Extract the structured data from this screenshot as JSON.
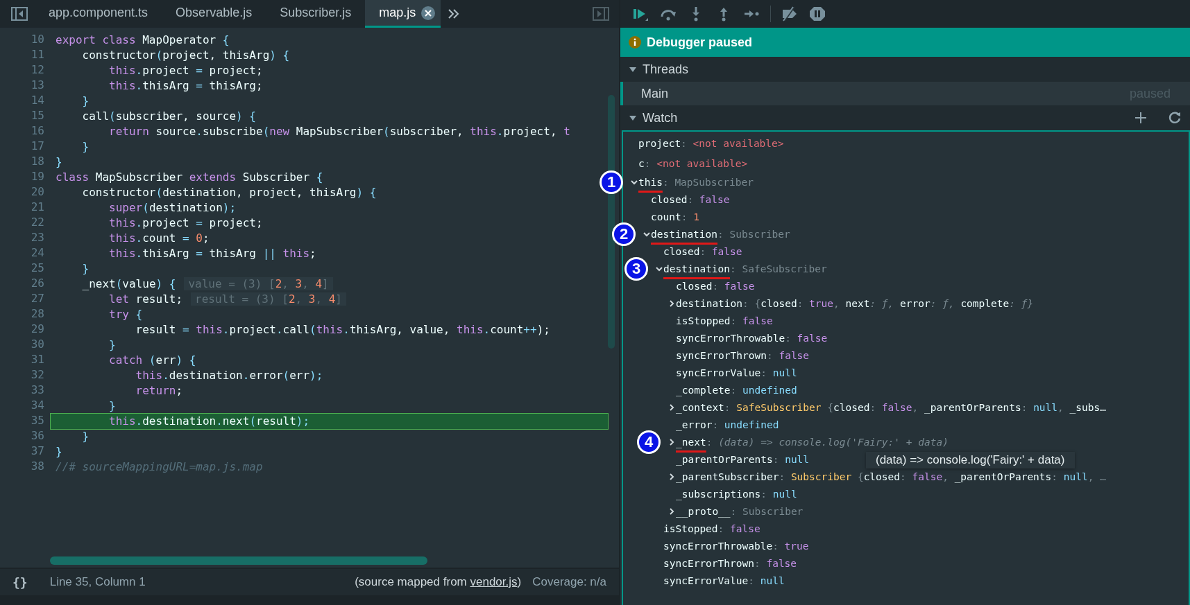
{
  "tabs": [
    {
      "label": "app.component.ts",
      "selected": false
    },
    {
      "label": "Observable.js",
      "selected": false
    },
    {
      "label": "Subscriber.js",
      "selected": false
    },
    {
      "label": "map.js",
      "selected": true
    }
  ],
  "code": [
    {
      "n": "10",
      "current": false,
      "tokens": [
        {
          "text": "export class ",
          "kind": "kw"
        },
        {
          "text": "MapOperator ",
          "kind": "id"
        },
        {
          "text": "{",
          "kind": "pu"
        }
      ]
    },
    {
      "n": "11",
      "current": false,
      "tokens": [
        {
          "text": "    constructor",
          "kind": "id"
        },
        {
          "text": "(",
          "kind": "pu"
        },
        {
          "text": "project, thisArg",
          "kind": "id"
        },
        {
          "text": ") {",
          "kind": "pu"
        }
      ]
    },
    {
      "n": "12",
      "current": false,
      "tokens": [
        {
          "text": "        this",
          "kind": "kw"
        },
        {
          "text": ".",
          "kind": "pu"
        },
        {
          "text": "project ",
          "kind": "id"
        },
        {
          "text": "=",
          "kind": "pu"
        },
        {
          "text": " project;",
          "kind": "id"
        }
      ]
    },
    {
      "n": "13",
      "current": false,
      "tokens": [
        {
          "text": "        this",
          "kind": "kw"
        },
        {
          "text": ".",
          "kind": "pu"
        },
        {
          "text": "thisArg ",
          "kind": "id"
        },
        {
          "text": "=",
          "kind": "pu"
        },
        {
          "text": " thisArg;",
          "kind": "id"
        }
      ]
    },
    {
      "n": "14",
      "current": false,
      "tokens": [
        {
          "text": "    }",
          "kind": "pu"
        }
      ]
    },
    {
      "n": "15",
      "current": false,
      "tokens": [
        {
          "text": "    call",
          "kind": "id"
        },
        {
          "text": "(",
          "kind": "pu"
        },
        {
          "text": "subscriber, source",
          "kind": "id"
        },
        {
          "text": ") {",
          "kind": "pu"
        }
      ]
    },
    {
      "n": "16",
      "current": false,
      "tokens": [
        {
          "text": "        return ",
          "kind": "kw"
        },
        {
          "text": "source",
          "kind": "id"
        },
        {
          "text": ".",
          "kind": "pu"
        },
        {
          "text": "subscribe",
          "kind": "id"
        },
        {
          "text": "(",
          "kind": "pu"
        },
        {
          "text": "new ",
          "kind": "kw"
        },
        {
          "text": "MapSubscriber",
          "kind": "id"
        },
        {
          "text": "(",
          "kind": "pu"
        },
        {
          "text": "subscriber, ",
          "kind": "id"
        },
        {
          "text": "this",
          "kind": "kw"
        },
        {
          "text": ".",
          "kind": "pu"
        },
        {
          "text": "project, ",
          "kind": "id"
        },
        {
          "text": "t",
          "kind": "kw"
        }
      ]
    },
    {
      "n": "17",
      "current": false,
      "tokens": [
        {
          "text": "    }",
          "kind": "pu"
        }
      ]
    },
    {
      "n": "18",
      "current": false,
      "tokens": [
        {
          "text": "}",
          "kind": "pu"
        }
      ]
    },
    {
      "n": "19",
      "current": false,
      "tokens": [
        {
          "text": "class ",
          "kind": "kw"
        },
        {
          "text": "MapSubscriber ",
          "kind": "id"
        },
        {
          "text": "extends ",
          "kind": "kw"
        },
        {
          "text": "Subscriber ",
          "kind": "id"
        },
        {
          "text": "{",
          "kind": "pu"
        }
      ]
    },
    {
      "n": "20",
      "current": false,
      "tokens": [
        {
          "text": "    constructor",
          "kind": "id"
        },
        {
          "text": "(",
          "kind": "pu"
        },
        {
          "text": "destination, project, thisArg",
          "kind": "id"
        },
        {
          "text": ") {",
          "kind": "pu"
        }
      ]
    },
    {
      "n": "21",
      "current": false,
      "tokens": [
        {
          "text": "        super",
          "kind": "kw"
        },
        {
          "text": "(",
          "kind": "pu"
        },
        {
          "text": "destination",
          "kind": "id"
        },
        {
          "text": ");",
          "kind": "pu"
        }
      ]
    },
    {
      "n": "22",
      "current": false,
      "tokens": [
        {
          "text": "        this",
          "kind": "kw"
        },
        {
          "text": ".",
          "kind": "pu"
        },
        {
          "text": "project ",
          "kind": "id"
        },
        {
          "text": "=",
          "kind": "pu"
        },
        {
          "text": " project;",
          "kind": "id"
        }
      ]
    },
    {
      "n": "23",
      "current": false,
      "tokens": [
        {
          "text": "        this",
          "kind": "kw"
        },
        {
          "text": ".",
          "kind": "pu"
        },
        {
          "text": "count ",
          "kind": "id"
        },
        {
          "text": "= ",
          "kind": "pu"
        },
        {
          "text": "0",
          "kind": "num"
        },
        {
          "text": ";",
          "kind": "id"
        }
      ]
    },
    {
      "n": "24",
      "current": false,
      "tokens": [
        {
          "text": "        this",
          "kind": "kw"
        },
        {
          "text": ".",
          "kind": "pu"
        },
        {
          "text": "thisArg ",
          "kind": "id"
        },
        {
          "text": "=",
          "kind": "pu"
        },
        {
          "text": " thisArg ",
          "kind": "id"
        },
        {
          "text": "|| ",
          "kind": "pu"
        },
        {
          "text": "this",
          "kind": "kw"
        },
        {
          "text": ";",
          "kind": "id"
        }
      ]
    },
    {
      "n": "25",
      "current": false,
      "tokens": [
        {
          "text": "    }",
          "kind": "pu"
        }
      ]
    },
    {
      "n": "26",
      "current": false,
      "tokens": [
        {
          "text": "    _next",
          "kind": "id"
        },
        {
          "text": "(",
          "kind": "pu"
        },
        {
          "text": "value",
          "kind": "id"
        },
        {
          "text": ") {",
          "kind": "pu"
        }
      ],
      "inline": [
        {
          "text": "value = (3) [",
          "kind": "dim"
        },
        {
          "text": "2",
          "kind": "num"
        },
        {
          "text": ", ",
          "kind": "dim"
        },
        {
          "text": "3",
          "kind": "num"
        },
        {
          "text": ", ",
          "kind": "dim"
        },
        {
          "text": "4",
          "kind": "num"
        },
        {
          "text": "]",
          "kind": "dim"
        }
      ]
    },
    {
      "n": "27",
      "current": false,
      "tokens": [
        {
          "text": "        let ",
          "kind": "kw"
        },
        {
          "text": "result;",
          "kind": "id"
        }
      ],
      "inline": [
        {
          "text": "result = (3) [",
          "kind": "dim"
        },
        {
          "text": "2",
          "kind": "num"
        },
        {
          "text": ", ",
          "kind": "dim"
        },
        {
          "text": "3",
          "kind": "num"
        },
        {
          "text": ", ",
          "kind": "dim"
        },
        {
          "text": "4",
          "kind": "num"
        },
        {
          "text": "]",
          "kind": "dim"
        }
      ]
    },
    {
      "n": "28",
      "current": false,
      "tokens": [
        {
          "text": "        try ",
          "kind": "kw"
        },
        {
          "text": "{",
          "kind": "pu"
        }
      ]
    },
    {
      "n": "29",
      "current": false,
      "tokens": [
        {
          "text": "            result ",
          "kind": "id"
        },
        {
          "text": "= ",
          "kind": "pu"
        },
        {
          "text": "this",
          "kind": "kw"
        },
        {
          "text": ".",
          "kind": "pu"
        },
        {
          "text": "project",
          "kind": "id"
        },
        {
          "text": ".",
          "kind": "pu"
        },
        {
          "text": "call",
          "kind": "id"
        },
        {
          "text": "(",
          "kind": "pu"
        },
        {
          "text": "this",
          "kind": "kw"
        },
        {
          "text": ".",
          "kind": "pu"
        },
        {
          "text": "thisArg, value, ",
          "kind": "id"
        },
        {
          "text": "this",
          "kind": "kw"
        },
        {
          "text": ".",
          "kind": "pu"
        },
        {
          "text": "count",
          "kind": "id"
        },
        {
          "text": "++",
          "kind": "pu"
        },
        {
          "text": ");",
          "kind": "id"
        }
      ]
    },
    {
      "n": "30",
      "current": false,
      "tokens": [
        {
          "text": "        }",
          "kind": "pu"
        }
      ]
    },
    {
      "n": "31",
      "current": false,
      "tokens": [
        {
          "text": "        catch ",
          "kind": "kw"
        },
        {
          "text": "(",
          "kind": "pu"
        },
        {
          "text": "err",
          "kind": "id"
        },
        {
          "text": ") {",
          "kind": "pu"
        }
      ]
    },
    {
      "n": "32",
      "current": false,
      "tokens": [
        {
          "text": "            this",
          "kind": "kw"
        },
        {
          "text": ".",
          "kind": "pu"
        },
        {
          "text": "destination",
          "kind": "id"
        },
        {
          "text": ".",
          "kind": "pu"
        },
        {
          "text": "error",
          "kind": "id"
        },
        {
          "text": "(",
          "kind": "pu"
        },
        {
          "text": "err",
          "kind": "id"
        },
        {
          "text": ");",
          "kind": "pu"
        }
      ]
    },
    {
      "n": "33",
      "current": false,
      "tokens": [
        {
          "text": "            return",
          "kind": "kw"
        },
        {
          "text": ";",
          "kind": "id"
        }
      ]
    },
    {
      "n": "34",
      "current": false,
      "tokens": [
        {
          "text": "        }",
          "kind": "pu"
        }
      ]
    },
    {
      "n": "35",
      "current": true,
      "tokens": [
        {
          "text": "        this",
          "kind": "kw"
        },
        {
          "text": ".",
          "kind": "pu"
        },
        {
          "text": "destination",
          "kind": "id"
        },
        {
          "text": ".",
          "kind": "pu"
        },
        {
          "text": "next",
          "kind": "id"
        },
        {
          "text": "(",
          "kind": "pu"
        },
        {
          "text": "result",
          "kind": "id"
        },
        {
          "text": ");",
          "kind": "pu"
        }
      ]
    },
    {
      "n": "36",
      "current": false,
      "tokens": [
        {
          "text": "    }",
          "kind": "pu"
        }
      ]
    },
    {
      "n": "37",
      "current": false,
      "tokens": [
        {
          "text": "}",
          "kind": "pu"
        }
      ]
    },
    {
      "n": "38",
      "current": false,
      "tokens": [
        {
          "text": "//# sourceMappingURL=map.js.map",
          "kind": "cm"
        }
      ]
    }
  ],
  "status_bar": {
    "pretty_print": "{}",
    "position": "Line 35, Column 1",
    "source_prefix": "(source mapped from ",
    "source_link": "vendor.js",
    "source_suffix": ")",
    "coverage": "Coverage: n/a"
  },
  "banner": "Debugger paused",
  "threads": {
    "title": "Threads",
    "expanded": true,
    "items": [
      {
        "name": "Main",
        "status": "paused",
        "selected": true
      }
    ]
  },
  "watch": {
    "title": "Watch",
    "expanded": true,
    "items": [
      {
        "name": "project",
        "value": [
          {
            "text": ": ",
            "kind": "dim"
          },
          {
            "text": "<not available>",
            "kind": "err"
          }
        ]
      },
      {
        "name": "c",
        "value": [
          {
            "text": ": ",
            "kind": "dim"
          },
          {
            "text": "<not available>",
            "kind": "err"
          }
        ]
      },
      {
        "name": "this",
        "value": [
          {
            "text": ": ",
            "kind": "dim"
          },
          {
            "text": "MapSubscriber",
            "kind": "type"
          }
        ],
        "expanded": true,
        "marker": "1",
        "underlined": true,
        "children": [
          {
            "name": "closed",
            "value": [
              {
                "text": ": ",
                "kind": "dim"
              },
              {
                "text": "false",
                "kind": "bool"
              }
            ]
          },
          {
            "name": "count",
            "value": [
              {
                "text": ": ",
                "kind": "dim"
              },
              {
                "text": "1",
                "kind": "num"
              }
            ]
          },
          {
            "name": "destination",
            "value": [
              {
                "text": ": ",
                "kind": "dim"
              },
              {
                "text": "Subscriber",
                "kind": "type"
              }
            ],
            "expanded": true,
            "marker": "2",
            "underlined": true,
            "children": [
              {
                "name": "closed",
                "value": [
                  {
                    "text": ": ",
                    "kind": "dim"
                  },
                  {
                    "text": "false",
                    "kind": "bool"
                  }
                ]
              },
              {
                "name": "destination",
                "value": [
                  {
                    "text": ": ",
                    "kind": "dim"
                  },
                  {
                    "text": "SafeSubscriber",
                    "kind": "type"
                  }
                ],
                "expanded": true,
                "marker": "3",
                "underlined": true,
                "children": [
                  {
                    "name": "closed",
                    "value": [
                      {
                        "text": ": ",
                        "kind": "dim"
                      },
                      {
                        "text": "false",
                        "kind": "bool"
                      }
                    ]
                  },
                  {
                    "name": "destination",
                    "expanded": false,
                    "value": [
                      {
                        "text": ": {",
                        "kind": "dim"
                      },
                      {
                        "text": "closed",
                        "kind": "plain"
                      },
                      {
                        "text": ": ",
                        "kind": "dim"
                      },
                      {
                        "text": "true",
                        "kind": "bool"
                      },
                      {
                        "text": ", ",
                        "kind": "dim"
                      },
                      {
                        "text": "next",
                        "kind": "plain"
                      },
                      {
                        "text": ": ƒ, ",
                        "kind": "fn"
                      },
                      {
                        "text": "error",
                        "kind": "plain"
                      },
                      {
                        "text": ": ƒ, ",
                        "kind": "fn"
                      },
                      {
                        "text": "complete",
                        "kind": "plain"
                      },
                      {
                        "text": ": ƒ}",
                        "kind": "fn"
                      }
                    ]
                  },
                  {
                    "name": "isStopped",
                    "value": [
                      {
                        "text": ": ",
                        "kind": "dim"
                      },
                      {
                        "text": "false",
                        "kind": "bool"
                      }
                    ]
                  },
                  {
                    "name": "syncErrorThrowable",
                    "value": [
                      {
                        "text": ": ",
                        "kind": "dim"
                      },
                      {
                        "text": "false",
                        "kind": "bool"
                      }
                    ]
                  },
                  {
                    "name": "syncErrorThrown",
                    "value": [
                      {
                        "text": ": ",
                        "kind": "dim"
                      },
                      {
                        "text": "false",
                        "kind": "bool"
                      }
                    ]
                  },
                  {
                    "name": "syncErrorValue",
                    "value": [
                      {
                        "text": ": ",
                        "kind": "dim"
                      },
                      {
                        "text": "null",
                        "kind": "null"
                      }
                    ]
                  },
                  {
                    "name": "_complete",
                    "value": [
                      {
                        "text": ": ",
                        "kind": "dim"
                      },
                      {
                        "text": "undefined",
                        "kind": "null"
                      }
                    ]
                  },
                  {
                    "name": "_context",
                    "expanded": false,
                    "value": [
                      {
                        "text": ": ",
                        "kind": "dim"
                      },
                      {
                        "text": "SafeSubscriber ",
                        "kind": "cls"
                      },
                      {
                        "text": "{",
                        "kind": "dim"
                      },
                      {
                        "text": "closed",
                        "kind": "plain"
                      },
                      {
                        "text": ": ",
                        "kind": "dim"
                      },
                      {
                        "text": "false",
                        "kind": "bool"
                      },
                      {
                        "text": ", ",
                        "kind": "dim"
                      },
                      {
                        "text": "_parentOrParents",
                        "kind": "plain"
                      },
                      {
                        "text": ": ",
                        "kind": "dim"
                      },
                      {
                        "text": "null",
                        "kind": "null"
                      },
                      {
                        "text": ", ",
                        "kind": "dim"
                      },
                      {
                        "text": "_subs…",
                        "kind": "plain"
                      }
                    ]
                  },
                  {
                    "name": "_error",
                    "value": [
                      {
                        "text": ": ",
                        "kind": "dim"
                      },
                      {
                        "text": "undefined",
                        "kind": "null"
                      }
                    ]
                  },
                  {
                    "name": "_next",
                    "expanded": false,
                    "marker": "4",
                    "underlined": true,
                    "value": [
                      {
                        "text": ": ",
                        "kind": "dim"
                      },
                      {
                        "text": "(data) => console.log('Fairy:' + data)",
                        "kind": "fn"
                      }
                    ],
                    "tooltip": "(data) => console.log('Fairy:' + data)"
                  },
                  {
                    "name": "_parentOrParents",
                    "value": [
                      {
                        "text": ": ",
                        "kind": "dim"
                      },
                      {
                        "text": "null",
                        "kind": "null"
                      }
                    ]
                  },
                  {
                    "name": "_parentSubscriber",
                    "expanded": false,
                    "value": [
                      {
                        "text": ": ",
                        "kind": "dim"
                      },
                      {
                        "text": "Subscriber ",
                        "kind": "cls"
                      },
                      {
                        "text": "{",
                        "kind": "dim"
                      },
                      {
                        "text": "closed",
                        "kind": "plain"
                      },
                      {
                        "text": ": ",
                        "kind": "dim"
                      },
                      {
                        "text": "false",
                        "kind": "bool"
                      },
                      {
                        "text": ", ",
                        "kind": "dim"
                      },
                      {
                        "text": "_parentOrParents",
                        "kind": "plain"
                      },
                      {
                        "text": ": ",
                        "kind": "dim"
                      },
                      {
                        "text": "null",
                        "kind": "null"
                      },
                      {
                        "text": ", …",
                        "kind": "dim"
                      }
                    ]
                  },
                  {
                    "name": "_subscriptions",
                    "value": [
                      {
                        "text": ": ",
                        "kind": "dim"
                      },
                      {
                        "text": "null",
                        "kind": "null"
                      }
                    ]
                  },
                  {
                    "name": "__proto__",
                    "expanded": false,
                    "value": [
                      {
                        "text": ": ",
                        "kind": "dim"
                      },
                      {
                        "text": "Subscriber",
                        "kind": "type"
                      }
                    ]
                  }
                ]
              },
              {
                "name": "isStopped",
                "value": [
                  {
                    "text": ": ",
                    "kind": "dim"
                  },
                  {
                    "text": "false",
                    "kind": "bool"
                  }
                ]
              },
              {
                "name": "syncErrorThrowable",
                "value": [
                  {
                    "text": ": ",
                    "kind": "dim"
                  },
                  {
                    "text": "true",
                    "kind": "bool"
                  }
                ]
              },
              {
                "name": "syncErrorThrown",
                "value": [
                  {
                    "text": ": ",
                    "kind": "dim"
                  },
                  {
                    "text": "false",
                    "kind": "bool"
                  }
                ]
              },
              {
                "name": "syncErrorValue",
                "value": [
                  {
                    "text": ": ",
                    "kind": "dim"
                  },
                  {
                    "text": "null",
                    "kind": "null"
                  }
                ]
              }
            ]
          }
        ]
      }
    ]
  }
}
